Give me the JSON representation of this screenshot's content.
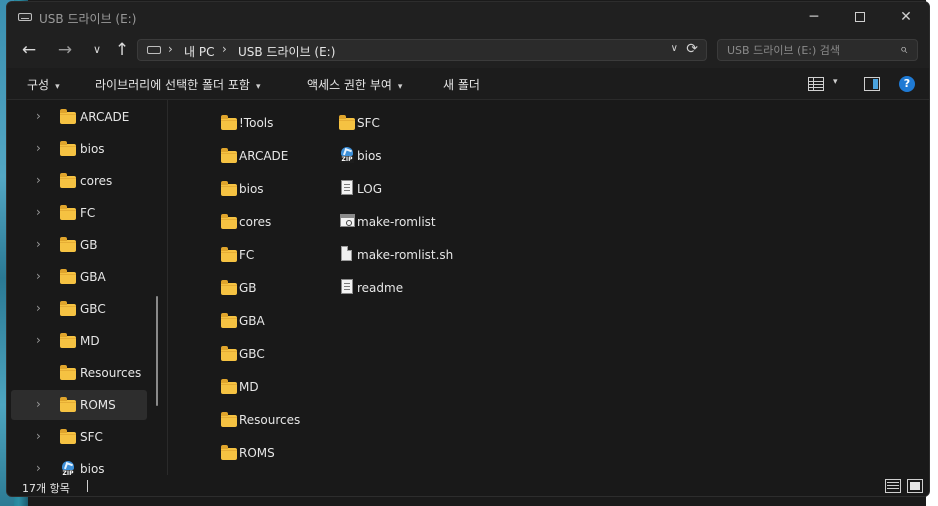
{
  "window": {
    "title": "USB 드라이브 (E:)",
    "controls": {
      "minimize": "─",
      "close": "✕"
    }
  },
  "nav": {
    "back_glyph": "←",
    "forward_glyph": "→",
    "recent_glyph": "∨",
    "up_glyph": "↑"
  },
  "address": {
    "crumbs": [
      "내 PC",
      "USB 드라이브 (E:)"
    ],
    "separator": "›",
    "dropdown_glyph": "∨",
    "refresh_glyph": "⟳"
  },
  "search": {
    "placeholder": "USB 드라이브 (E:) 검색",
    "icon_glyph": "⌕"
  },
  "commands": {
    "organize": "구성",
    "include_in_library": "라이브러리에 선택한 폴더 포함",
    "share_with": "액세스 권한 부여",
    "new_folder": "새 폴더",
    "caret": "▾",
    "help": "?"
  },
  "tree": {
    "chevron": "›",
    "items": [
      {
        "label": "ARCADE",
        "icon": "folder-icon",
        "expandable": true
      },
      {
        "label": "bios",
        "icon": "folder-icon",
        "expandable": true
      },
      {
        "label": "cores",
        "icon": "folder-icon",
        "expandable": true
      },
      {
        "label": "FC",
        "icon": "folder-icon",
        "expandable": true
      },
      {
        "label": "GB",
        "icon": "folder-icon",
        "expandable": true
      },
      {
        "label": "GBA",
        "icon": "folder-icon",
        "expandable": true
      },
      {
        "label": "GBC",
        "icon": "folder-icon",
        "expandable": true
      },
      {
        "label": "MD",
        "icon": "folder-icon",
        "expandable": true
      },
      {
        "label": "Resources",
        "icon": "folder-icon",
        "expandable": false
      },
      {
        "label": "ROMS",
        "icon": "folder-icon",
        "expandable": true,
        "selected": true
      },
      {
        "label": "SFC",
        "icon": "folder-icon",
        "expandable": true
      },
      {
        "label": "bios",
        "icon": "zip-icon",
        "expandable": true
      }
    ]
  },
  "files": {
    "column1": [
      {
        "name": "!Tools",
        "icon": "folder-icon"
      },
      {
        "name": "ARCADE",
        "icon": "folder-icon"
      },
      {
        "name": "bios",
        "icon": "folder-icon"
      },
      {
        "name": "cores",
        "icon": "folder-icon"
      },
      {
        "name": "FC",
        "icon": "folder-icon"
      },
      {
        "name": "GB",
        "icon": "folder-icon"
      },
      {
        "name": "GBA",
        "icon": "folder-icon"
      },
      {
        "name": "GBC",
        "icon": "folder-icon"
      },
      {
        "name": "MD",
        "icon": "folder-icon"
      },
      {
        "name": "Resources",
        "icon": "folder-icon"
      },
      {
        "name": "ROMS",
        "icon": "folder-icon"
      }
    ],
    "column2": [
      {
        "name": "SFC",
        "icon": "folder-icon"
      },
      {
        "name": "bios",
        "icon": "zip-icon"
      },
      {
        "name": "LOG",
        "icon": "text-file-icon"
      },
      {
        "name": "make-romlist",
        "icon": "script-file-icon"
      },
      {
        "name": "make-romlist.sh",
        "icon": "blank-file-icon"
      },
      {
        "name": "readme",
        "icon": "text-file-icon"
      }
    ]
  },
  "status": {
    "item_count": "17개 항목"
  },
  "colors": {
    "window_bg": "#191919",
    "folder": "#f5c242",
    "accent": "#1f7ad4"
  }
}
